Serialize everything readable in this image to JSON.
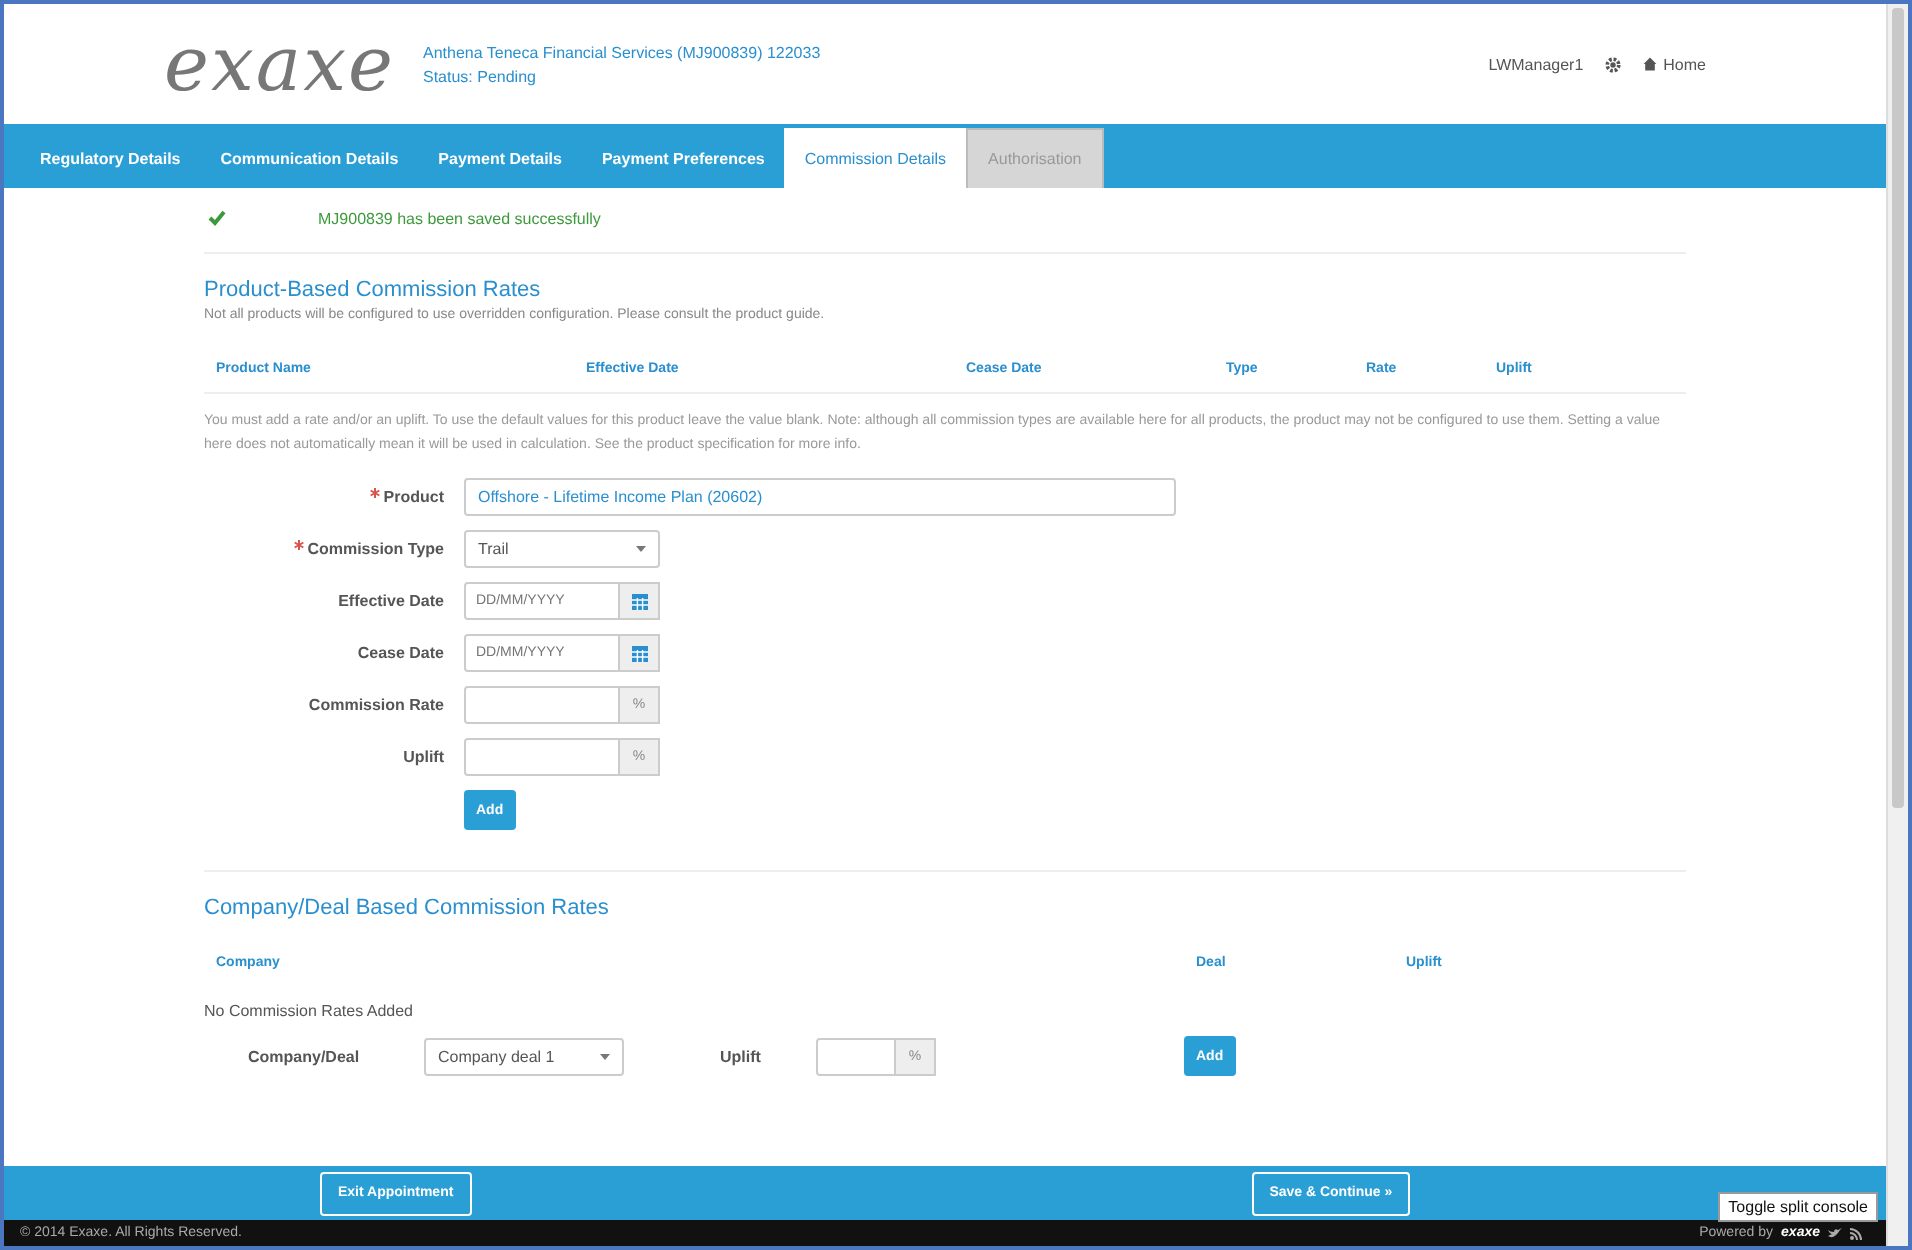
{
  "header": {
    "logo": "exaxe",
    "account": "Anthena Teneca Financial Services (MJ900839) 122033",
    "status": "Status: Pending",
    "user": "LWManager1",
    "home": "Home"
  },
  "tabs": [
    {
      "label": "Regulatory Details",
      "selected": false,
      "disabled": false
    },
    {
      "label": "Communication Details",
      "selected": false,
      "disabled": false
    },
    {
      "label": "Payment Details",
      "selected": false,
      "disabled": false
    },
    {
      "label": "Payment Preferences",
      "selected": false,
      "disabled": false
    },
    {
      "label": "Commission Details",
      "selected": true,
      "disabled": false
    },
    {
      "label": "Authorisation",
      "selected": false,
      "disabled": true
    }
  ],
  "alert": {
    "message": "MJ900839 has been saved successfully"
  },
  "product_rates": {
    "title": "Product-Based Commission Rates",
    "description": "Not all products will be configured to use overridden configuration. Please consult the product guide.",
    "columns": [
      "Product Name",
      "Effective Date",
      "Cease Date",
      "Type",
      "Rate",
      "Uplift"
    ],
    "hint": "You must add a rate and/or an uplift. To use the default values for this product leave the value blank. Note: although all commission types are available here for all products, the product may not be configured to use them. Setting a value here does not automatically mean it will be used in calculation. See the product specification for more info.",
    "fields": [
      {
        "kind": "text",
        "label": "Product",
        "required": true,
        "value": "Offshore - Lifetime Income Plan (20602)"
      },
      {
        "kind": "select",
        "label": "Commission Type",
        "required": true,
        "value": "Trail"
      },
      {
        "kind": "date",
        "label": "Effective Date",
        "required": false,
        "placeholder": "DD/MM/YYYY"
      },
      {
        "kind": "date",
        "label": "Cease Date",
        "required": false,
        "placeholder": "DD/MM/YYYY"
      },
      {
        "kind": "percent",
        "label": "Commission Rate",
        "required": false,
        "addon": "%"
      },
      {
        "kind": "percent",
        "label": "Uplift",
        "required": false,
        "addon": "%"
      }
    ],
    "add_button": "Add"
  },
  "company_rates": {
    "title": "Company/Deal Based Commission Rates",
    "columns": [
      "Company",
      "Deal",
      "Uplift"
    ],
    "empty": "No Commission Rates Added",
    "company_label": "Company/Deal",
    "company_value": "Company deal 1",
    "uplift_label": "Uplift",
    "uplift_addon": "%",
    "add_button": "Add"
  },
  "footer": {
    "exit_button": "Exit Appointment",
    "save_button": "Save & Continue »",
    "copyright": "© 2014 Exaxe. All Rights Reserved.",
    "powered": "Powered by",
    "brand": "exaxe",
    "tooltip": "Toggle split console"
  }
}
